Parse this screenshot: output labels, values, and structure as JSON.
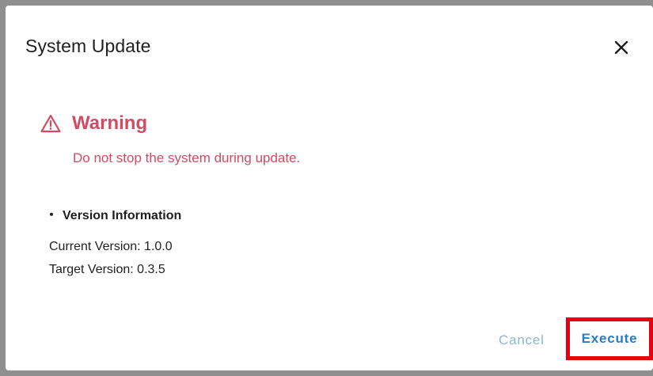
{
  "dialog": {
    "title": "System Update",
    "close_icon": "close-icon"
  },
  "warning": {
    "icon": "warning-triangle-icon",
    "title": "Warning",
    "message": "Do not stop the system during update."
  },
  "version_info": {
    "heading": "Version Information",
    "bullet": "・",
    "current": "Current Version: 1.0.0",
    "target": "Target Version: 0.3.5"
  },
  "actions": {
    "cancel_label": "Cancel",
    "execute_label": "Execute"
  },
  "colors": {
    "warning": "#d14b62",
    "primary": "#2a7bc4",
    "cancel": "#8fb3d6",
    "highlight": "#e8000c"
  }
}
